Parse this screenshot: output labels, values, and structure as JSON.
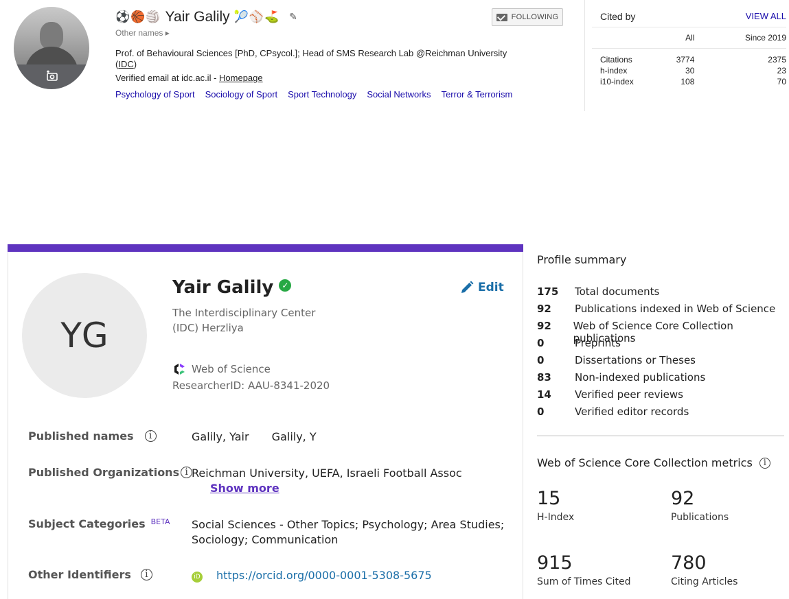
{
  "scholar": {
    "emoji_left": "⚽🏀🏐",
    "name": "Yair Galily",
    "emoji_right": "🎾⚾⛳",
    "other_names": "Other names ▸",
    "bio_line1": "Prof. of Behavioural Sciences [PhD, CPsycol.]; Head of SMS Research Lab @Reichman University",
    "bio_line2": "IDC",
    "bio_open": "(",
    "bio_close": ")",
    "email_text": "Verified email at idc.ac.il - ",
    "homepage": "Homepage",
    "tags": [
      "Psychology of Sport",
      "Sociology of Sport",
      "Sport Technology",
      "Social Networks",
      "Terror & Terrorism"
    ],
    "follow_label": "FOLLOWING",
    "cited_by": {
      "title": "Cited by",
      "view_all": "VIEW ALL",
      "columns": [
        "All",
        "Since 2019"
      ],
      "rows": [
        {
          "label": "Citations",
          "all": "3774",
          "since": "2375"
        },
        {
          "label": "h-index",
          "all": "30",
          "since": "23"
        },
        {
          "label": "i10-index",
          "all": "108",
          "since": "70"
        }
      ]
    }
  },
  "wos": {
    "initials": "YG",
    "name": "Yair Galily",
    "edit_label": "Edit",
    "org_line1": "The Interdisciplinary Center",
    "org_line2": "(IDC) Herzliya",
    "source": "Web of Science",
    "researcher_id": "ResearcherID: AAU-8341-2020",
    "published_names_label": "Published names",
    "published_names": [
      "Galily, Yair",
      "Galily, Y"
    ],
    "published_orgs_label": "Published Organizations",
    "published_orgs": "Reichman University,  UEFA,  Israeli Football Assoc",
    "show_more": "Show more",
    "subject_label": "Subject Categories",
    "beta": "BETA",
    "subject_line1": "Social Sciences - Other Topics;  Psychology;  Area Studies;",
    "subject_line2": "Sociology;  Communication",
    "other_ids_label": "Other Identifiers",
    "orcid_badge": "iD",
    "orcid_url": "https://orcid.org/0000-0001-5308-5675",
    "info_glyph": "i",
    "edit_color": "#1a6ea8",
    "accent_color": "#5e33bf",
    "profile_summary": {
      "title": "Profile summary",
      "items": [
        {
          "n": "175",
          "label": "Total documents"
        },
        {
          "n": "92",
          "label": "Publications indexed in Web of Science"
        },
        {
          "n": "92",
          "label": "Web of Science Core Collection publications"
        },
        {
          "n": "0",
          "label": "Preprints"
        },
        {
          "n": "0",
          "label": "Dissertations or Theses"
        },
        {
          "n": "83",
          "label": "Non-indexed publications"
        },
        {
          "n": "14",
          "label": "Verified peer reviews"
        },
        {
          "n": "0",
          "label": "Verified editor records"
        }
      ]
    },
    "metrics": {
      "title": "Web of Science Core Collection metrics",
      "h_index": {
        "value": "15",
        "label": "H-Index"
      },
      "publications": {
        "value": "92",
        "label": "Publications"
      },
      "times_cited": {
        "value": "915",
        "label": "Sum of Times Cited"
      },
      "citing_articles": {
        "value": "780",
        "label": "Citing Articles"
      }
    }
  }
}
